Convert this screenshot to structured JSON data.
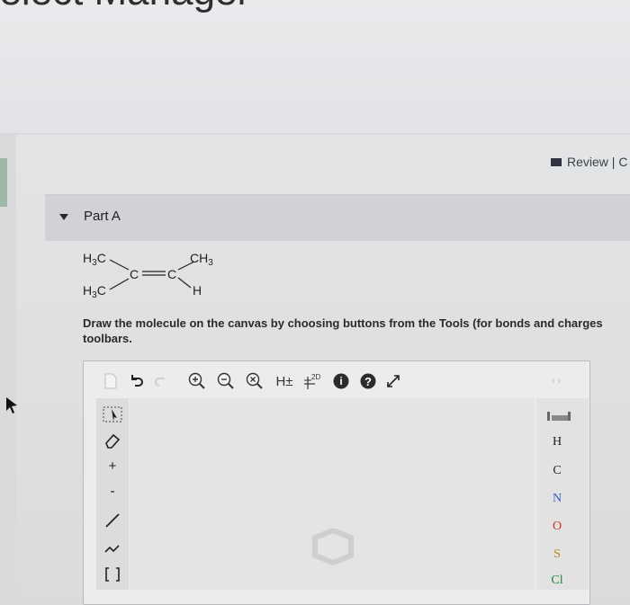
{
  "header": {
    "title_fragment": "Select Manager"
  },
  "review": {
    "label": "Review | C"
  },
  "part": {
    "label": "Part A"
  },
  "molecule": {
    "h3c_top": "H3C",
    "h3c_bottom": "H3C",
    "ch3": "CH3",
    "double_bond": "C=C",
    "h": "H"
  },
  "instructions": "Draw the molecule on the canvas by choosing buttons from the Tools (for bonds and charges\ntoolbars.",
  "toolbar": {
    "h_toggle": "H±",
    "twod": "2D",
    "info": "i",
    "help": "?"
  },
  "left_toolbar": {
    "plus": "+",
    "minus": "-"
  },
  "elements": [
    "H",
    "C",
    "N",
    "O",
    "S",
    "Cl"
  ],
  "colors": {
    "N": "#3a5bbf",
    "O": "#d62f1f",
    "S": "#b98b17",
    "Cl": "#1a8a3a"
  }
}
